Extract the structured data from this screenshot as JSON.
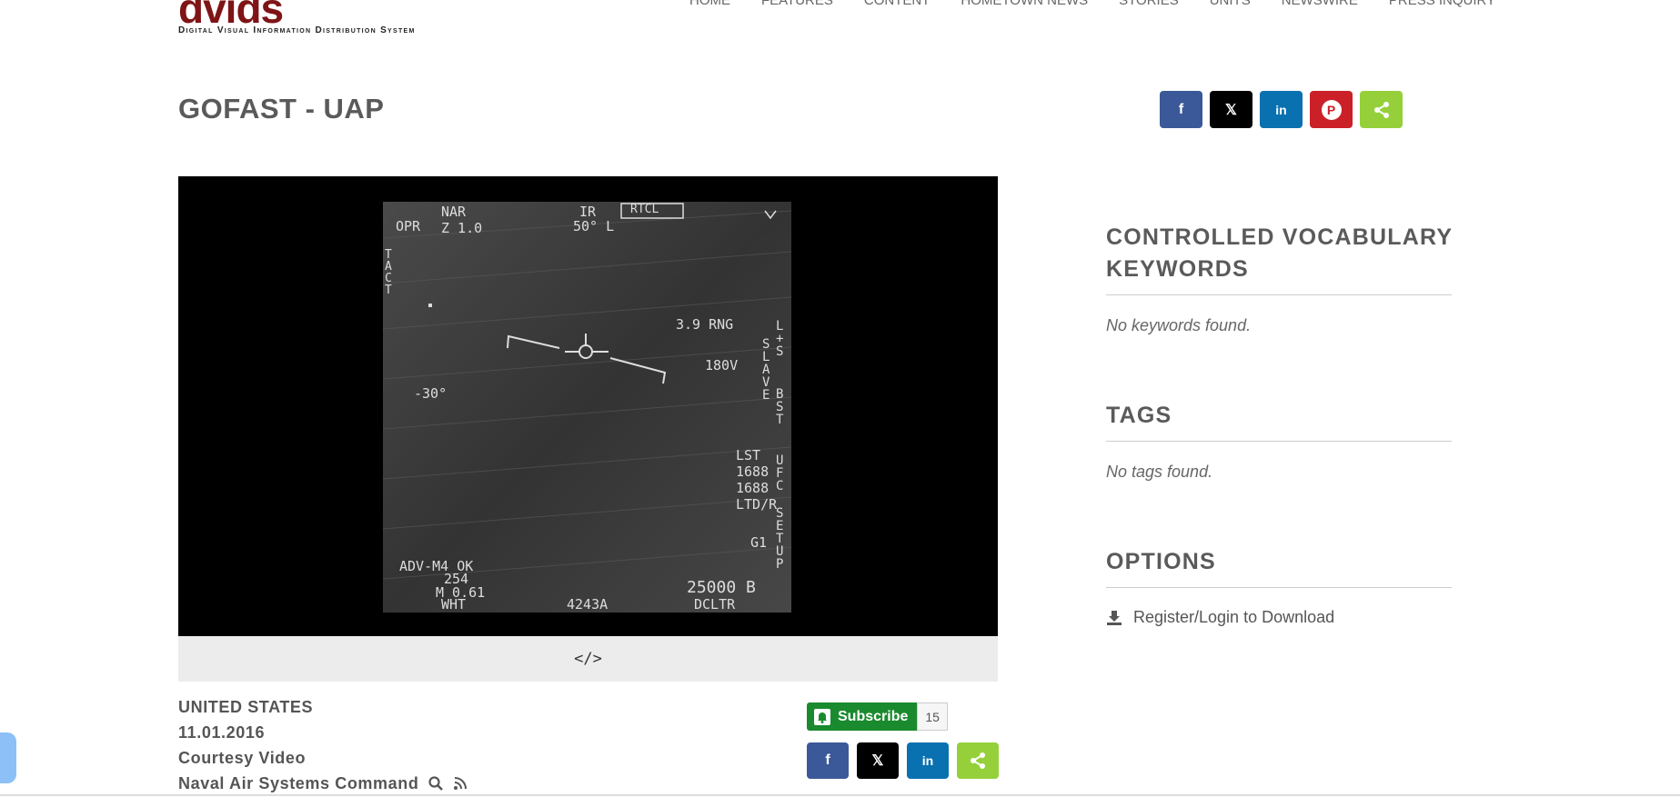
{
  "header": {
    "logo": "dvids",
    "logo_sub": "Digital Visual Information Distribution System",
    "nav": [
      "HOME",
      "FEATURES",
      "CONTENT",
      "HOMETOWN NEWS",
      "STORIES",
      "UNITS",
      "NEWSWIRE",
      "PRESS INQUIRY"
    ]
  },
  "page": {
    "title": "GOFAST - UAP"
  },
  "share": {
    "facebook": "f",
    "x": "𝕏",
    "linkedin": "in",
    "pinterest": "P",
    "share": "<"
  },
  "video": {
    "hud": {
      "opr": "OPR",
      "nar": "NAR",
      "z": "Z 1.0",
      "ir": "IR",
      "rtcl": "RTCL",
      "fov": "50° L",
      "tact": "TACT",
      "rng": "3.9 RNG",
      "hdg": "180V",
      "angle": "-30°",
      "slave": "SLAVE",
      "lst": "LST",
      "n1": "1688",
      "n2": "1688",
      "ltd": "LTD/R",
      "g1": "G1",
      "ls": "L+S",
      "bst": "BST",
      "ufc": "UFC",
      "setup": "SETUP",
      "adv": "ADV-M4 OK",
      "n254": "254",
      "mach": "M 0.61",
      "wht": "WHT",
      "code": "4243A",
      "alt": "25000 B",
      "dcltr": "DCLTR"
    },
    "embed_label": "</>"
  },
  "meta": {
    "country": "UNITED STATES",
    "date": "11.01.2016",
    "credit": "Courtesy Video",
    "unit": "Naval Air Systems Command"
  },
  "subscribe": {
    "label": "Subscribe",
    "count": "15"
  },
  "sidebar": {
    "keywords_heading_1": "CONTROLLED VOCABULARY",
    "keywords_heading_2": "KEYWORDS",
    "keywords_empty": "No keywords found.",
    "tags_heading": "TAGS",
    "tags_empty": "No tags found.",
    "options_heading": "OPTIONS",
    "download_label": "Register/Login to Download"
  }
}
